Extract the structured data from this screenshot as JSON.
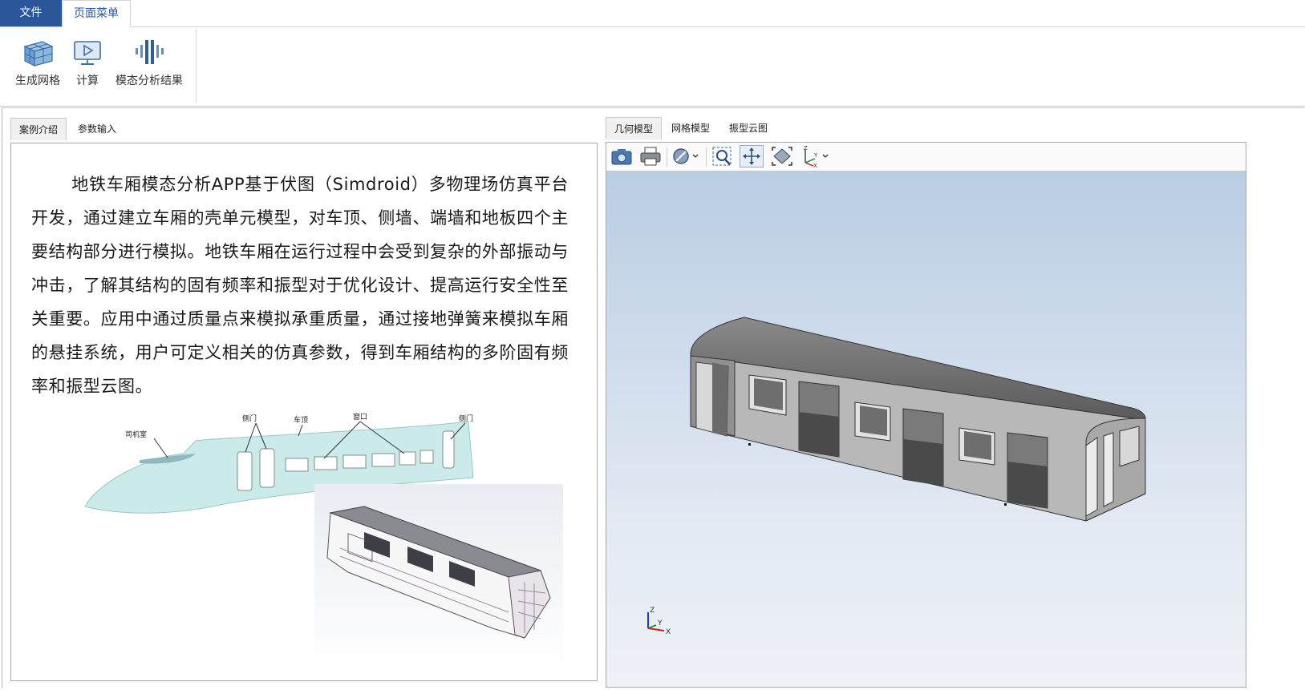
{
  "menu": {
    "file": "文件",
    "page_menu": "页面菜单"
  },
  "ribbon": {
    "generate_mesh": "生成网格",
    "compute": "计算",
    "modal_results": "模态分析结果"
  },
  "left_tabs": [
    {
      "label": "案例介绍",
      "active": true
    },
    {
      "label": "参数输入",
      "active": false
    }
  ],
  "intro": {
    "paragraph": "地铁车厢模态分析APP基于伏图（Simdroid）多物理场仿真平台开发，通过建立车厢的壳单元模型，对车顶、侧墙、端墙和地板四个主要结构部分进行模拟。地铁车厢在运行过程中会受到复杂的外部振动与冲击，了解其结构的固有频率和振型对于优化设计、提高运行安全性至关重要。应用中通过质量点来模拟承重质量，通过接地弹簧来模拟车厢的悬挂系统，用户可定义相关的仿真参数，得到车厢结构的多阶固有频率和振型云图。"
  },
  "illustration": {
    "labels": {
      "cab": "司机室",
      "side_door_1": "侧门",
      "roof": "车顶",
      "window": "窗口",
      "side_door_2": "侧门"
    }
  },
  "right_tabs": [
    {
      "label": "几何模型",
      "active": true
    },
    {
      "label": "网格模型",
      "active": false
    },
    {
      "label": "振型云图",
      "active": false
    }
  ],
  "toolbar": {
    "icons": [
      "camera-icon",
      "print-icon",
      "display-mode-icon",
      "zoom-box-icon",
      "pan-icon",
      "fit-view-icon",
      "axis-orient-icon"
    ]
  },
  "triad": {
    "z": "Z",
    "y": "Y",
    "x": "X"
  },
  "colors": {
    "accent": "#2b579a",
    "viewport_top": "#b9cde3",
    "viewport_bottom": "#eef1f6"
  }
}
